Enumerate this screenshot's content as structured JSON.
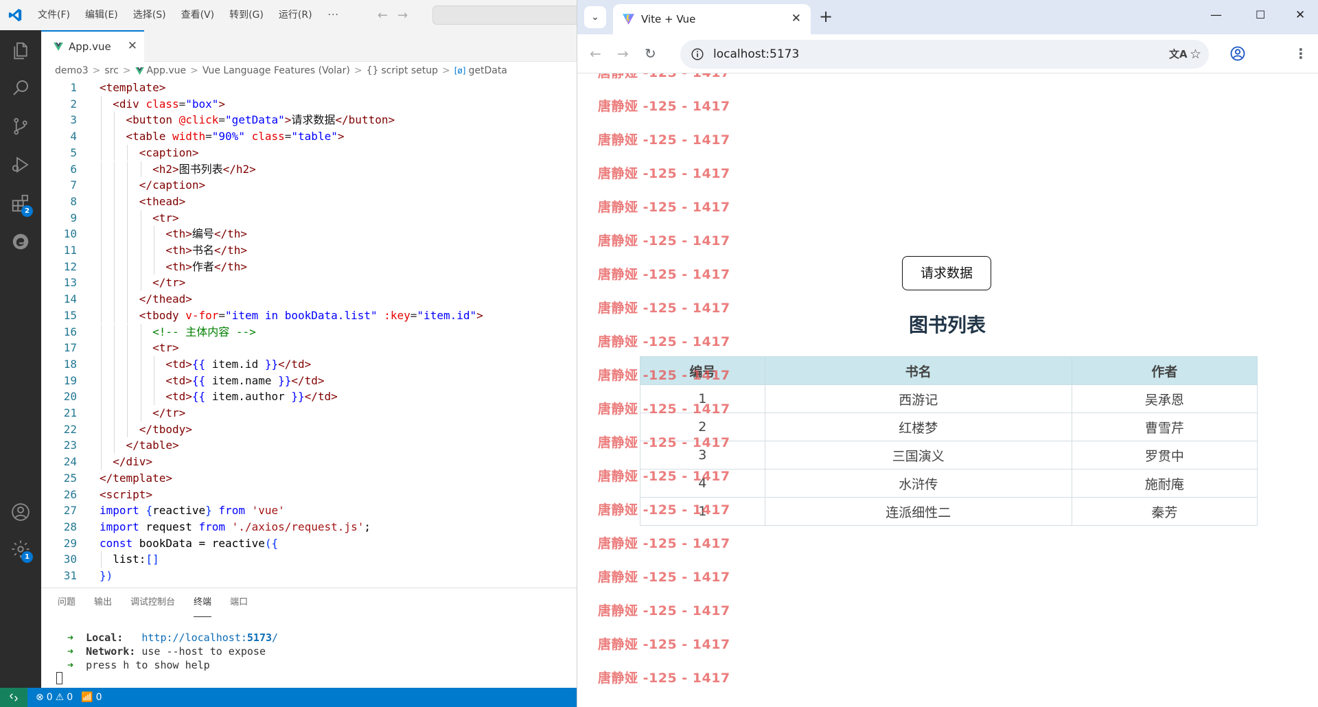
{
  "vscode": {
    "menu": [
      "文件(F)",
      "编辑(E)",
      "选择(S)",
      "查看(V)",
      "转到(G)",
      "运行(R)"
    ],
    "menu_more": "···",
    "file_tab": "App.vue",
    "breadcrumb": [
      "demo3",
      "src",
      "App.vue",
      "Vue Language Features (Volar)",
      "script setup",
      "getData"
    ],
    "extensions_badge": "2",
    "settings_badge": "1",
    "code_lines": [
      {
        "n": "1",
        "t": "<template>"
      },
      {
        "n": "2",
        "t": "  <div class=\"box\">"
      },
      {
        "n": "3",
        "t": "    <button @click=\"getData\">请求数据</button>"
      },
      {
        "n": "4",
        "t": "    <table width=\"90%\" class=\"table\">"
      },
      {
        "n": "5",
        "t": "      <caption>"
      },
      {
        "n": "6",
        "t": "        <h2>图书列表</h2>"
      },
      {
        "n": "7",
        "t": "      </caption>"
      },
      {
        "n": "8",
        "t": "      <thead>"
      },
      {
        "n": "9",
        "t": "        <tr>"
      },
      {
        "n": "10",
        "t": "          <th>编号</th>"
      },
      {
        "n": "11",
        "t": "          <th>书名</th>"
      },
      {
        "n": "12",
        "t": "          <th>作者</th>"
      },
      {
        "n": "13",
        "t": "        </tr>"
      },
      {
        "n": "14",
        "t": "      </thead>"
      },
      {
        "n": "15",
        "t": "      <tbody v-for=\"item in bookData.list\" :key=\"item.id\">"
      },
      {
        "n": "16",
        "t": "        <!-- 主体内容 -->"
      },
      {
        "n": "17",
        "t": "        <tr>"
      },
      {
        "n": "18",
        "t": "          <td>{{ item.id }}</td>"
      },
      {
        "n": "19",
        "t": "          <td>{{ item.name }}</td>"
      },
      {
        "n": "20",
        "t": "          <td>{{ item.author }}</td>"
      },
      {
        "n": "21",
        "t": "        </tr>"
      },
      {
        "n": "22",
        "t": "      </tbody>"
      },
      {
        "n": "23",
        "t": "    </table>"
      },
      {
        "n": "24",
        "t": "  </div>"
      },
      {
        "n": "25",
        "t": "</template>"
      },
      {
        "n": "26",
        "t": "<script setup>"
      },
      {
        "n": "27",
        "t": "import {reactive} from 'vue'"
      },
      {
        "n": "28",
        "t": "import request from './axios/request.js';"
      },
      {
        "n": "29",
        "t": "const bookData = reactive({"
      },
      {
        "n": "30",
        "t": "  list:[]"
      },
      {
        "n": "31",
        "t": "})"
      }
    ],
    "panel_tabs": [
      "问题",
      "输出",
      "调试控制台",
      "终端",
      "端口"
    ],
    "active_panel_tab": "终端",
    "terminal": {
      "local_label": "Local:",
      "local_url_base": "http://localhost:",
      "local_port": "5173",
      "local_url_end": "/",
      "network_label": "Network:",
      "network_text": "use --host to expose",
      "help_text": "press h to show help"
    },
    "status": {
      "errors": "0",
      "warnings": "0",
      "ports": "0"
    }
  },
  "browser": {
    "tab_title": "Vite + Vue",
    "url": "localhost:5173",
    "watermark": "唐静娅 -125 - 1417",
    "button_label": "请求数据",
    "table_title": "图书列表",
    "columns": [
      "编号",
      "书名",
      "作者"
    ],
    "rows": [
      [
        "1",
        "西游记",
        "吴承恩"
      ],
      [
        "2",
        "红楼梦",
        "曹雪芹"
      ],
      [
        "3",
        "三国演义",
        "罗贯中"
      ],
      [
        "4",
        "水浒传",
        "施耐庵"
      ],
      [
        "1",
        "连派细性二",
        "秦芳"
      ]
    ]
  },
  "colors": {
    "vscode_accent": "#007acc",
    "activity_bar": "#2c2c2c",
    "watermark": "#e55252",
    "table_header": "#cbe6ed",
    "heading": "#213547"
  }
}
